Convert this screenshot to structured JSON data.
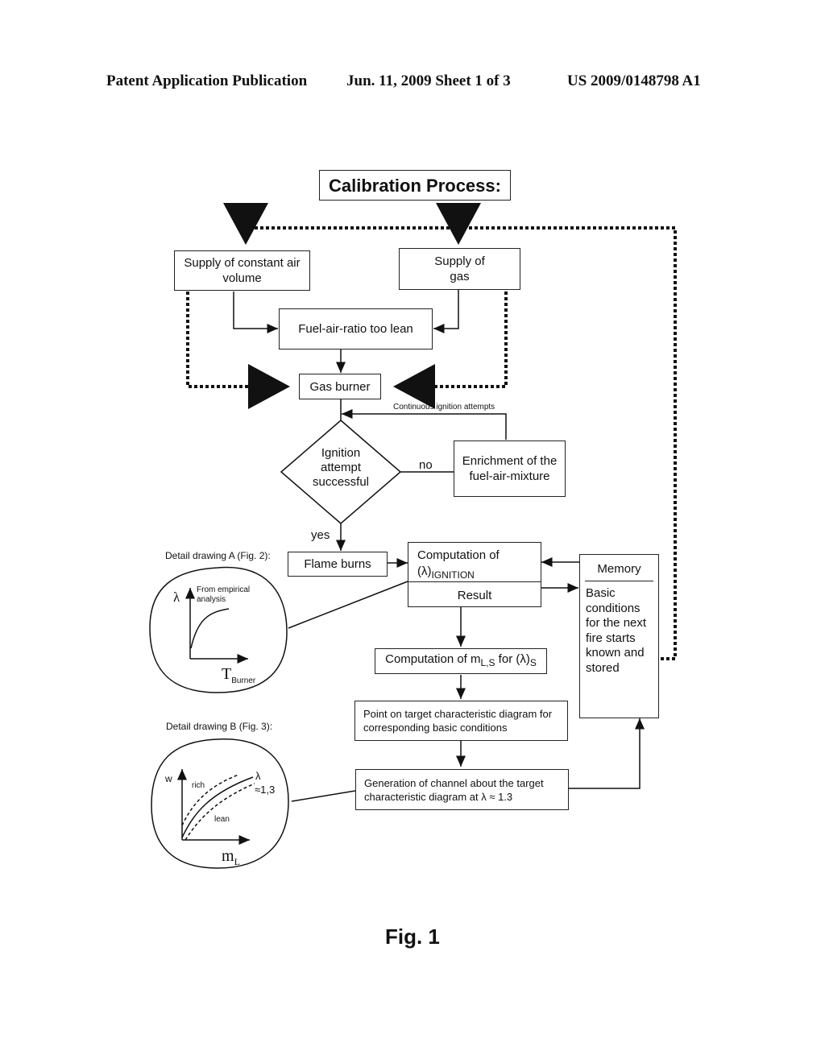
{
  "header": {
    "publication": "Patent Application Publication",
    "date_sheet": "Jun. 11, 2009  Sheet 1 of 3",
    "number": "US 2009/0148798 A1"
  },
  "title": "Calibration Process:",
  "nodes": {
    "air": "Supply of constant air volume",
    "gas_line1": "Supply of",
    "gas_line2": "gas",
    "lean": "Fuel-air-ratio too lean",
    "burner": "Gas burner",
    "decision_l1": "Ignition",
    "decision_l2": "attempt",
    "decision_l3": "successful",
    "enrich": "Enrichment of the fuel-air-mixture",
    "flame": "Flame burns",
    "comp_l1": "Computation of",
    "comp_lambda": "(λ)",
    "comp_sub": "IGNITION",
    "result": "Result",
    "compm_pre": "Computation of m",
    "compm_sub": "L,S",
    "compm_mid": " for (λ)",
    "compm_sub2": "S",
    "point": "Point on target characteristic diagram for corresponding basic conditions",
    "channel": "Generation of channel about the target characteristic  diagram at λ ≈ 1.3",
    "memory_title": "Memory",
    "memory_body": "Basic conditions for the next fire starts known and stored"
  },
  "labels": {
    "continuous": "Continuous ignition attempts",
    "no": "no",
    "yes": "yes"
  },
  "detail_a": {
    "caption": "Detail drawing A (Fig. 2):",
    "yaxis": "λ",
    "note_l1": "From empirical",
    "note_l2": "analysis",
    "xaxis": "T",
    "xaxis_sub": "Burner"
  },
  "detail_b": {
    "caption": "Detail drawing B (Fig. 3):",
    "yaxis": "w",
    "rich": "rich",
    "lean": "lean",
    "lambda": "λ",
    "lambda_val": "≈1,3",
    "xaxis": "m",
    "xaxis_sub": "L"
  },
  "figure_label": "Fig. 1"
}
